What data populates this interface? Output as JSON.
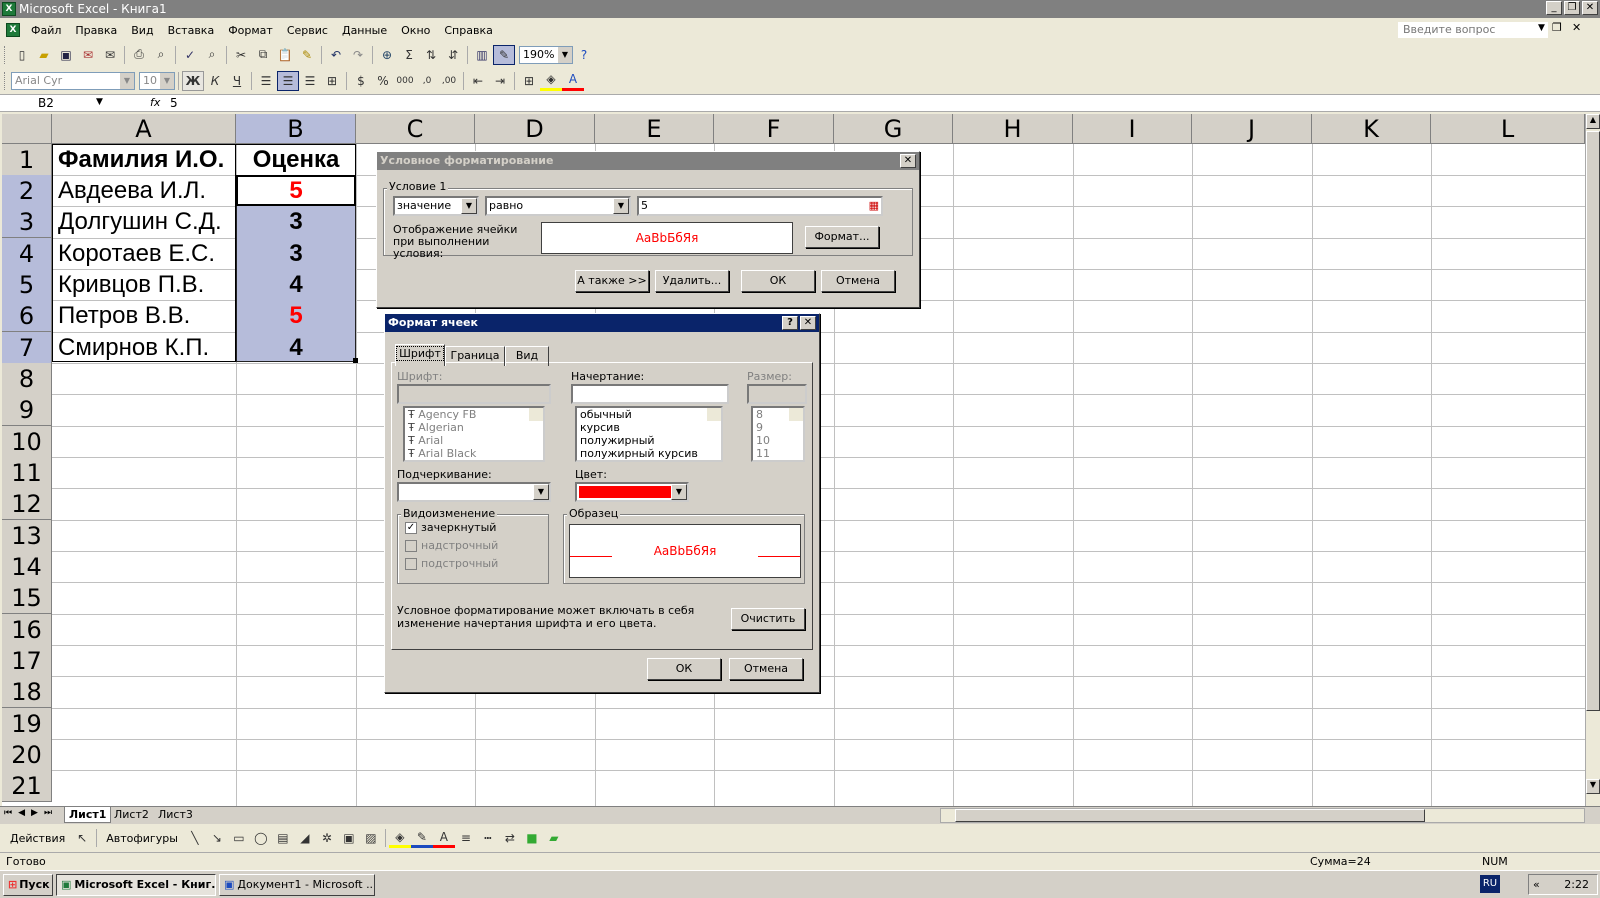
{
  "window": {
    "title": "Microsoft Excel - Книга1",
    "icon": "excel-icon"
  },
  "menu": [
    "Файл",
    "Правка",
    "Вид",
    "Вставка",
    "Формат",
    "Сервис",
    "Данные",
    "Окно",
    "Справка"
  ],
  "ask_placeholder": "Введите вопрос",
  "toolbar": {
    "zoom": "190%",
    "font_name": "Arial Cyr",
    "font_size": "10"
  },
  "formula": {
    "name_box": "B2",
    "fx": "fx",
    "value": "5"
  },
  "columns": [
    "A",
    "B",
    "C",
    "D",
    "E",
    "F",
    "G",
    "H",
    "I",
    "J",
    "K",
    "L"
  ],
  "rows": [
    "1",
    "2",
    "3",
    "4",
    "5",
    "6",
    "7",
    "8",
    "9",
    "10",
    "11",
    "12",
    "13",
    "14",
    "15",
    "16",
    "17",
    "18",
    "19",
    "20",
    "21"
  ],
  "table": {
    "header_a": "Фамилия И.О.",
    "header_b": "Оценка",
    "names": [
      "Авдеева И.Л.",
      "Долгушин С.Д.",
      "Коротаев Е.С.",
      "Кривцов П.В.",
      "Петров В.В.",
      "Смирнов К.П."
    ],
    "grades": [
      "5",
      "3",
      "3",
      "4",
      "5",
      "4"
    ]
  },
  "sheets": [
    "Лист1",
    "Лист2",
    "Лист3"
  ],
  "drawbar": {
    "actions": "Действия",
    "autoshapes": "Автофигуры"
  },
  "status": {
    "ready": "Готово",
    "sum": "Сумма=24",
    "num": "NUM"
  },
  "taskbar": {
    "start": "Пуск",
    "items": [
      "Microsoft Excel - Книг...",
      "Документ1 - Microsoft ..."
    ],
    "lang": "RU",
    "chevron": "«",
    "clock": "2:22"
  },
  "cond_dialog": {
    "title": "Условное форматирование",
    "condition_label": "Условие 1",
    "type_value": "значение",
    "op_value": "равно",
    "arg_value": "5",
    "preview_label": "Отображение ячейки при выполнении условия:",
    "preview_text": "AaBbБбЯя",
    "format_btn": "Формат...",
    "also_btn": "А также >>",
    "delete_btn": "Удалить...",
    "ok": "ОК",
    "cancel": "Отмена"
  },
  "format_dialog": {
    "title": "Формат ячеек",
    "help": "?",
    "tabs": [
      "Шрифт",
      "Граница",
      "Вид"
    ],
    "font_label": "Шрифт:",
    "fonts": [
      "Agency FB",
      "Algerian",
      "Arial",
      "Arial Black"
    ],
    "style_label": "Начертание:",
    "styles": [
      "обычный",
      "курсив",
      "полужирный",
      "полужирный курсив"
    ],
    "size_label": "Размер:",
    "sizes": [
      "8",
      "9",
      "10",
      "11"
    ],
    "underline_label": "Подчеркивание:",
    "color_label": "Цвет:",
    "color_value": "#ff0000",
    "effects_label": "Видоизменение",
    "effects": [
      "зачеркнутый",
      "надстрочный",
      "подстрочный"
    ],
    "sample_label": "Образец",
    "sample_text": "AaBbБбЯя",
    "note": "Условное форматирование может включать в себя изменение начертания шрифта и его цвета.",
    "clear_btn": "Очистить",
    "ok": "ОК",
    "cancel": "Отмена"
  }
}
